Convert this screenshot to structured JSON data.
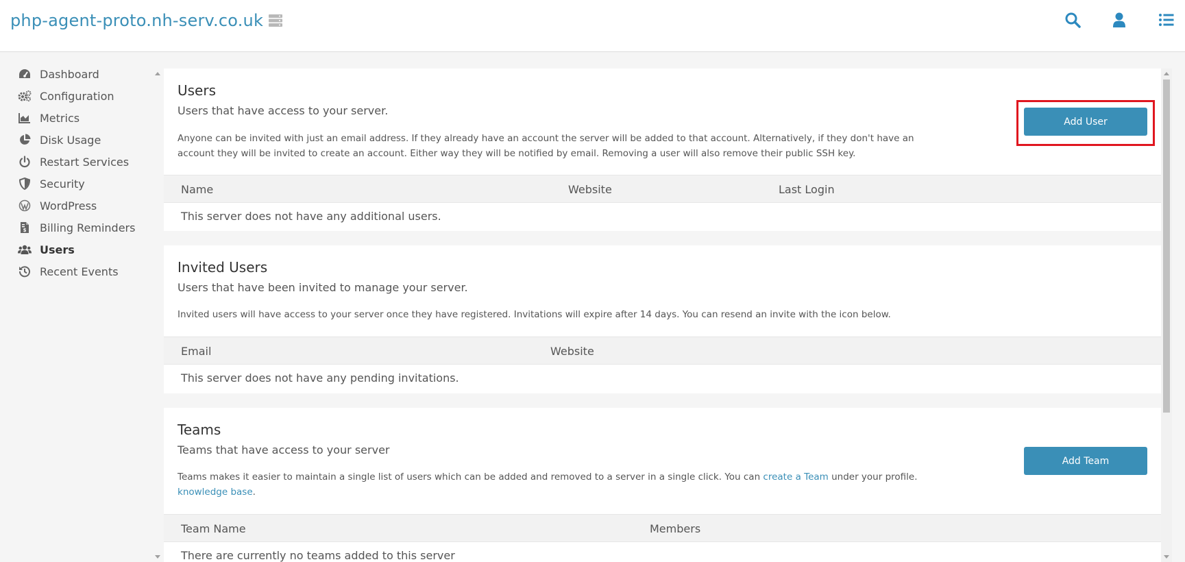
{
  "header": {
    "site_title": "php-agent-proto.nh-serv.co.uk",
    "icons": [
      "server-icon",
      "search-icon",
      "user-icon",
      "menu-list-icon"
    ]
  },
  "sidebar": {
    "items": [
      {
        "label": "Dashboard",
        "icon": "dashboard-icon"
      },
      {
        "label": "Configuration",
        "icon": "gears-icon"
      },
      {
        "label": "Metrics",
        "icon": "area-chart-icon"
      },
      {
        "label": "Disk Usage",
        "icon": "pie-chart-icon"
      },
      {
        "label": "Restart Services",
        "icon": "power-icon"
      },
      {
        "label": "Security",
        "icon": "shield-icon"
      },
      {
        "label": "WordPress",
        "icon": "wordpress-icon"
      },
      {
        "label": "Billing Reminders",
        "icon": "invoice-icon"
      },
      {
        "label": "Users",
        "icon": "users-icon",
        "active": true
      },
      {
        "label": "Recent Events",
        "icon": "history-icon"
      }
    ]
  },
  "users": {
    "title": "Users",
    "subtitle": "Users that have access to your server.",
    "description_line1": "Anyone can be invited with just an email address. If they already have an account the server will be added to that account. Alternatively, if they don't have an",
    "description_line2": "account they will be invited to create an account. Either way they will be notified by email. Removing a user will also remove their public SSH key.",
    "button_label": "Add User",
    "columns": [
      "Name",
      "Website",
      "Last Login"
    ],
    "empty_message": "This server does not have any additional users."
  },
  "invited": {
    "title": "Invited Users",
    "subtitle": "Users that have been invited to manage your server.",
    "description": "Invited users will have access to your server once they have registered. Invitations will expire after 14 days. You can resend an invite with the icon below.",
    "columns": [
      "Email",
      "Website"
    ],
    "empty_message": "This server does not have any pending invitations."
  },
  "teams": {
    "title": "Teams",
    "subtitle": "Teams that have access to your server",
    "description_before_link": "Teams makes it easier to maintain a single list of users which can be added and removed to a server in a single click. You can ",
    "link_create_team": "create a Team",
    "description_after_link": " under your profile.",
    "link_knowledge_base": "knowledge base",
    "description_end": ".",
    "button_label": "Add Team",
    "columns": [
      "Team Name",
      "Members"
    ],
    "empty_message": "There are currently no teams added to this server"
  },
  "colors": {
    "accent": "#3a8fb7",
    "highlight": "#e0161f"
  }
}
